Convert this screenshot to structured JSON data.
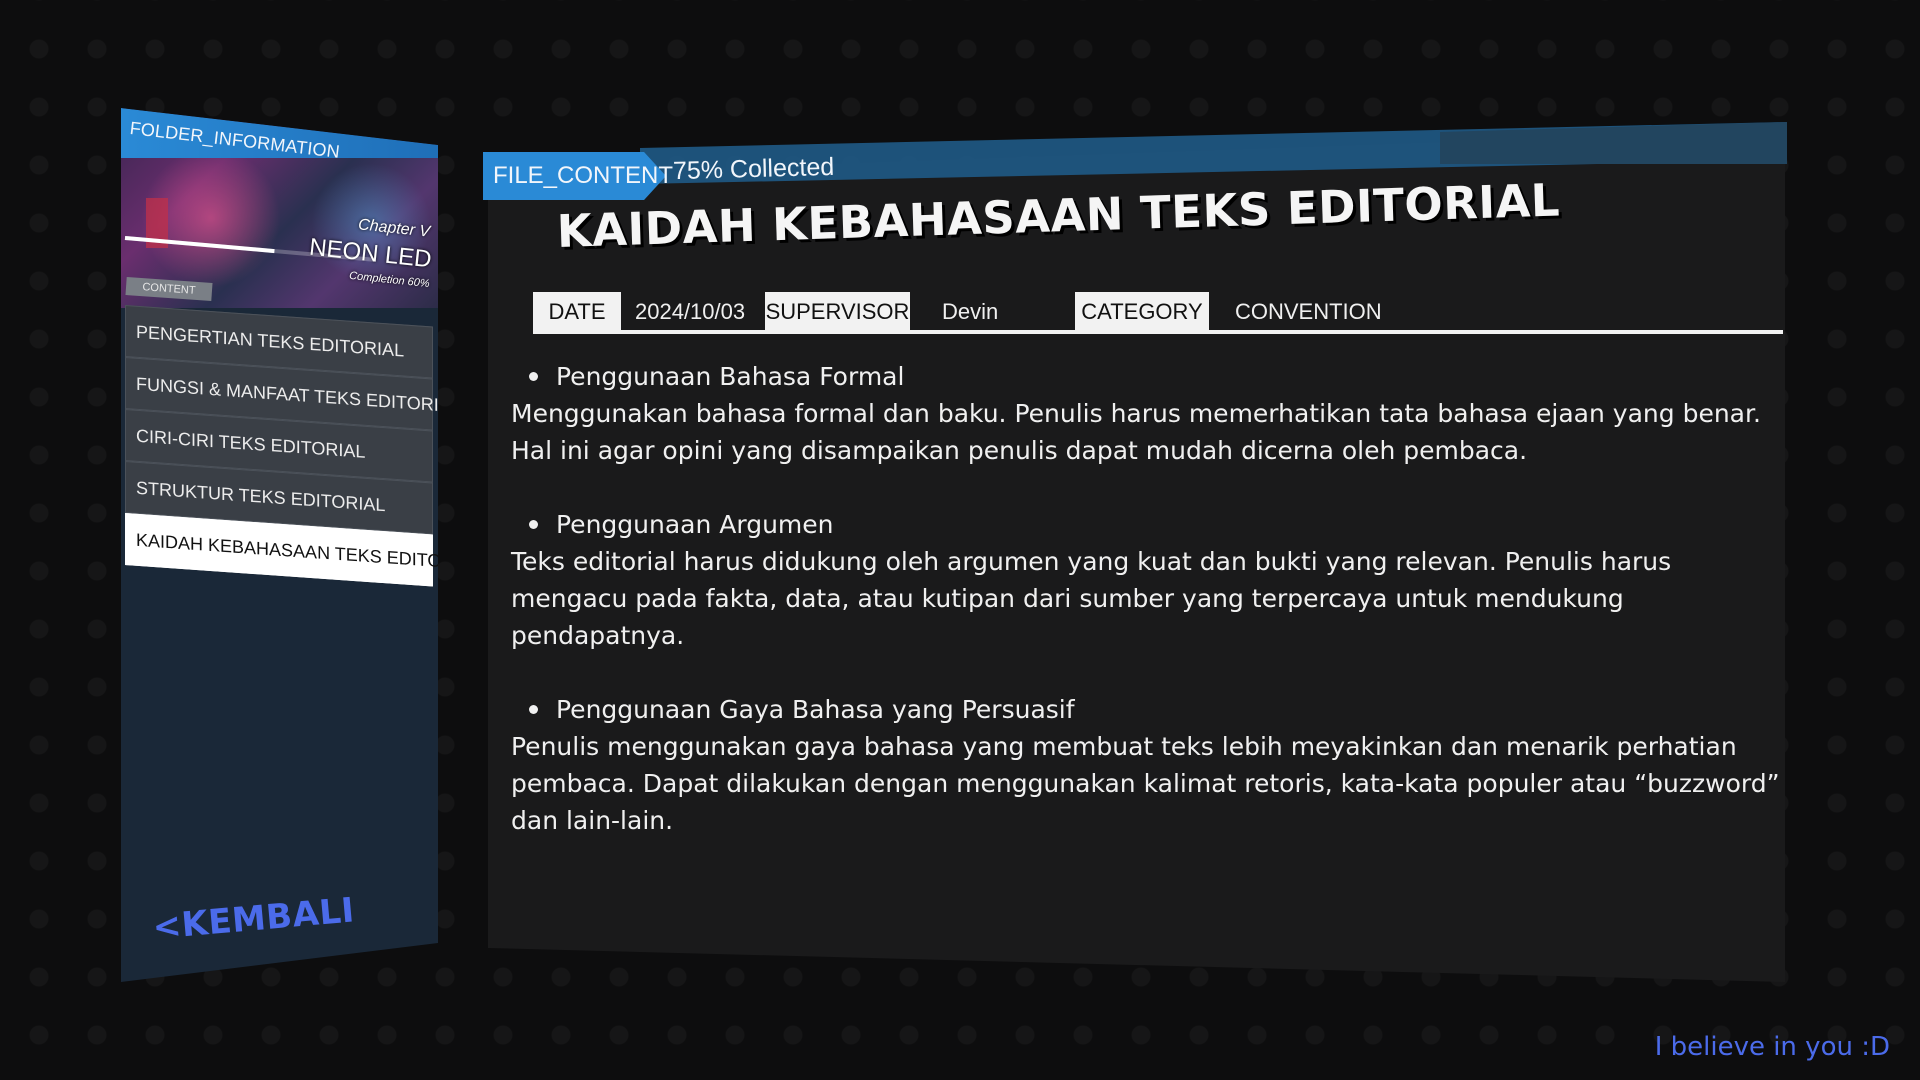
{
  "sidebar": {
    "folder_title": "FOLDER_INFORMATION",
    "chapter": "Chapter V",
    "chapter_name": "NEON LED",
    "completion_label": "Completion 60%",
    "completion_value": 0.6,
    "content_tag": "CONTENT",
    "items": [
      {
        "label": "PENGERTIAN TEKS EDITORIAL",
        "active": false
      },
      {
        "label": "FUNGSI & MANFAAT TEKS EDITORIAL",
        "active": false
      },
      {
        "label": "CIRI-CIRI TEKS EDITORIAL",
        "active": false
      },
      {
        "label": "STRUKTUR TEKS EDITORIAL",
        "active": false
      },
      {
        "label": "KAIDAH KEBAHASAAN TEKS EDITORIAL",
        "active": true
      }
    ],
    "back_label": "<KEMBALI"
  },
  "header": {
    "file_tab": "FILE_CONTENT",
    "collected": "75% Collected"
  },
  "main": {
    "title": "KAIDAH KEBAHASAAN TEKS EDITORIAL",
    "meta": {
      "date_label": "DATE",
      "date_value": "2024/10/03",
      "supervisor_label": "SUPERVISOR",
      "supervisor_value": "Devin",
      "category_label": "CATEGORY",
      "category_value": "CONVENTION"
    },
    "sections": [
      {
        "heading": "Penggunaan Bahasa Formal",
        "text": "Menggunakan bahasa formal dan baku. Penulis harus memerhatikan tata bahasa ejaan yang benar.\nHal ini agar opini yang disampaikan penulis dapat mudah dicerna oleh pembaca."
      },
      {
        "heading": "Penggunaan Argumen",
        "text": "Teks editorial harus didukung oleh argumen yang kuat dan bukti yang relevan. Penulis harus\nmengacu pada fakta, data, atau kutipan dari sumber yang terpercaya untuk mendukung\npendapatnya."
      },
      {
        "heading": "Penggunaan Gaya Bahasa yang Persuasif",
        "text": "Penulis menggunakan gaya bahasa yang membuat teks lebih meyakinkan dan menarik perhatian\npembaca. Dapat dilakukan dengan menggunakan kalimat retoris, kata-kata populer atau “buzzword”\ndan lain-lain."
      }
    ]
  },
  "footer": {
    "note": "I believe in you :D"
  },
  "colors": {
    "accent_blue": "#2a8ad6",
    "back_link": "#4b6bea",
    "panel_bg": "#1a1a1b",
    "sidebar_bg": "#1a2838"
  }
}
